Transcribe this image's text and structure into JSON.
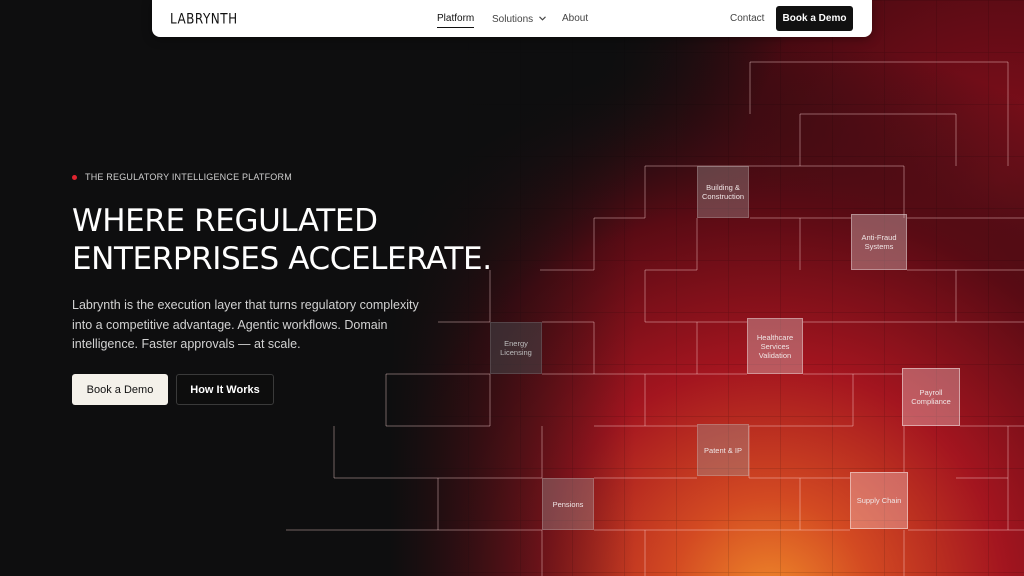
{
  "nav": {
    "logo": "LABRYNTH",
    "links": [
      "Platform",
      "Solutions",
      "About"
    ],
    "contact": "Contact",
    "cta": "Book a Demo"
  },
  "hero": {
    "eyebrow": "THE REGULATORY INTELLIGENCE PLATFORM",
    "headline_line1": "WHERE REGULATED",
    "headline_line2": "ENTERPRISES ACCELERATE.",
    "subtext": "Labrynth is the execution layer that turns regulatory complexity into a competitive advantage. Agentic workflows. Domain intelligence. Faster approvals — at scale.",
    "primary_cta": "Book a Demo",
    "secondary_cta": "How It Works"
  },
  "tiles": {
    "building": "Building & Construction",
    "antifraud": "Anti-Fraud Systems",
    "energy": "Energy Licensing",
    "healthcare": "Healthcare Services Validation",
    "payroll": "Payroll Compliance",
    "patent": "Patent & IP",
    "pensions": "Pensions",
    "supply": "Supply Chain"
  },
  "colors": {
    "accent_red": "#e0242f",
    "background": "#0e0e0f",
    "glow_orange": "#e0862e"
  }
}
